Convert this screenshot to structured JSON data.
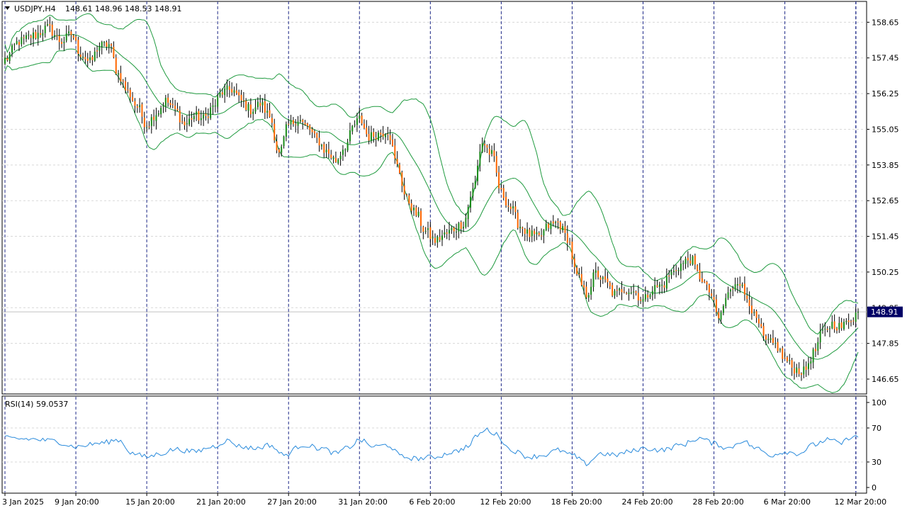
{
  "header": {
    "symbol": "USDJPY,H4",
    "ohlc": "148.61 148.96 148.53 148.91"
  },
  "colors": {
    "background": "#ffffff",
    "frame": "#000000",
    "grid": "#d8d8d8",
    "session_sep": "#1f2a8a",
    "bull": "#1a8a1a",
    "bear": "#ff6600",
    "wick": "#000000",
    "bands": "#1e9a3e",
    "rsi": "#2a8bdc",
    "price_badge": "#000066"
  },
  "price_badge": "148.91",
  "rsi_panel": {
    "label": "RSI(14) 59.0537",
    "levels": [
      "100",
      "70",
      "30",
      "0"
    ]
  },
  "chart_data": {
    "type": "candlestick",
    "symbol": "USDJPY",
    "timeframe": "H4",
    "last_price": 148.91,
    "ylim": [
      146.15,
      159.35
    ],
    "y_ticks": [
      158.65,
      157.45,
      156.25,
      155.05,
      153.85,
      152.65,
      151.45,
      150.25,
      149.05,
      147.85,
      146.65
    ],
    "y_tick_labels": [
      "158.65",
      "157.45",
      "156.25",
      "155.05",
      "153.85",
      "152.65",
      "151.45",
      "150.25",
      "149.05",
      "147.85",
      "146.65"
    ],
    "x_tick_labels": [
      "3 Jan 2025",
      "9 Jan 20:00",
      "15 Jan 20:00",
      "21 Jan 20:00",
      "27 Jan 20:00",
      "31 Jan 20:00",
      "6 Feb 20:00",
      "12 Feb 20:00",
      "18 Feb 20:00",
      "24 Feb 20:00",
      "28 Feb 20:00",
      "6 Mar 20:00",
      "12 Mar 20:00"
    ],
    "x_tick_bar_index": [
      0,
      30,
      60,
      90,
      120,
      150,
      180,
      210,
      240,
      270,
      300,
      330,
      360
    ],
    "num_bars": 362,
    "close_path": [
      [
        0,
        157.4
      ],
      [
        6,
        158.0
      ],
      [
        12,
        158.2
      ],
      [
        18,
        158.45
      ],
      [
        24,
        158.0
      ],
      [
        28,
        158.25
      ],
      [
        32,
        157.6
      ],
      [
        36,
        157.3
      ],
      [
        40,
        157.85
      ],
      [
        44,
        157.9
      ],
      [
        48,
        156.9
      ],
      [
        52,
        156.3
      ],
      [
        56,
        155.8
      ],
      [
        60,
        155.2
      ],
      [
        64,
        155.6
      ],
      [
        68,
        156.0
      ],
      [
        72,
        155.7
      ],
      [
        76,
        155.2
      ],
      [
        80,
        155.5
      ],
      [
        84,
        155.4
      ],
      [
        88,
        155.8
      ],
      [
        92,
        156.3
      ],
      [
        96,
        156.4
      ],
      [
        100,
        156.0
      ],
      [
        104,
        155.7
      ],
      [
        108,
        155.9
      ],
      [
        112,
        155.5
      ],
      [
        116,
        154.2
      ],
      [
        120,
        155.2
      ],
      [
        124,
        155.4
      ],
      [
        128,
        155.1
      ],
      [
        132,
        154.7
      ],
      [
        136,
        154.3
      ],
      [
        140,
        154.0
      ],
      [
        144,
        154.5
      ],
      [
        148,
        155.2
      ],
      [
        150,
        155.4
      ],
      [
        154,
        154.8
      ],
      [
        158,
        154.9
      ],
      [
        162,
        155.0
      ],
      [
        166,
        153.8
      ],
      [
        170,
        152.7
      ],
      [
        174,
        152.2
      ],
      [
        178,
        151.6
      ],
      [
        182,
        151.3
      ],
      [
        186,
        151.5
      ],
      [
        190,
        151.7
      ],
      [
        194,
        151.9
      ],
      [
        198,
        153.0
      ],
      [
        202,
        154.6
      ],
      [
        206,
        154.2
      ],
      [
        210,
        152.9
      ],
      [
        214,
        152.4
      ],
      [
        218,
        151.8
      ],
      [
        222,
        151.5
      ],
      [
        226,
        151.4
      ],
      [
        230,
        151.8
      ],
      [
        234,
        151.9
      ],
      [
        238,
        151.4
      ],
      [
        242,
        150.1
      ],
      [
        246,
        149.5
      ],
      [
        250,
        150.2
      ],
      [
        254,
        149.9
      ],
      [
        258,
        149.5
      ],
      [
        262,
        149.7
      ],
      [
        266,
        149.6
      ],
      [
        270,
        149.3
      ],
      [
        274,
        149.7
      ],
      [
        278,
        149.8
      ],
      [
        282,
        150.2
      ],
      [
        286,
        150.5
      ],
      [
        290,
        150.7
      ],
      [
        294,
        150.1
      ],
      [
        298,
        149.6
      ],
      [
        302,
        148.7
      ],
      [
        306,
        149.5
      ],
      [
        310,
        150.0
      ],
      [
        314,
        149.4
      ],
      [
        318,
        148.6
      ],
      [
        322,
        147.9
      ],
      [
        326,
        147.8
      ],
      [
        330,
        147.3
      ],
      [
        334,
        147.0
      ],
      [
        338,
        146.9
      ],
      [
        342,
        147.5
      ],
      [
        346,
        148.2
      ],
      [
        350,
        148.5
      ],
      [
        354,
        148.4
      ],
      [
        358,
        148.7
      ],
      [
        361,
        148.91
      ]
    ],
    "rsi_path": [
      [
        0,
        58
      ],
      [
        10,
        57
      ],
      [
        20,
        55
      ],
      [
        30,
        48
      ],
      [
        40,
        52
      ],
      [
        48,
        56
      ],
      [
        54,
        40
      ],
      [
        60,
        36
      ],
      [
        66,
        40
      ],
      [
        72,
        45
      ],
      [
        80,
        42
      ],
      [
        88,
        48
      ],
      [
        94,
        55
      ],
      [
        100,
        48
      ],
      [
        106,
        46
      ],
      [
        112,
        50
      ],
      [
        118,
        38
      ],
      [
        126,
        50
      ],
      [
        134,
        46
      ],
      [
        140,
        40
      ],
      [
        146,
        48
      ],
      [
        150,
        56
      ],
      [
        156,
        48
      ],
      [
        162,
        50
      ],
      [
        168,
        36
      ],
      [
        174,
        34
      ],
      [
        182,
        36
      ],
      [
        190,
        42
      ],
      [
        196,
        48
      ],
      [
        200,
        62
      ],
      [
        204,
        68
      ],
      [
        208,
        62
      ],
      [
        214,
        44
      ],
      [
        222,
        36
      ],
      [
        228,
        38
      ],
      [
        234,
        44
      ],
      [
        240,
        38
      ],
      [
        246,
        28
      ],
      [
        252,
        40
      ],
      [
        258,
        38
      ],
      [
        264,
        42
      ],
      [
        270,
        46
      ],
      [
        278,
        44
      ],
      [
        286,
        50
      ],
      [
        294,
        58
      ],
      [
        300,
        52
      ],
      [
        306,
        46
      ],
      [
        312,
        55
      ],
      [
        318,
        46
      ],
      [
        324,
        38
      ],
      [
        330,
        42
      ],
      [
        336,
        40
      ],
      [
        342,
        50
      ],
      [
        348,
        56
      ],
      [
        354,
        52
      ],
      [
        358,
        60
      ],
      [
        361,
        59.05
      ]
    ],
    "rsi_ylim": [
      0,
      100
    ],
    "rsi_level_values": [
      100,
      70,
      30,
      0
    ],
    "indicators": [
      "Bollinger Bands",
      "RSI(14)"
    ]
  }
}
